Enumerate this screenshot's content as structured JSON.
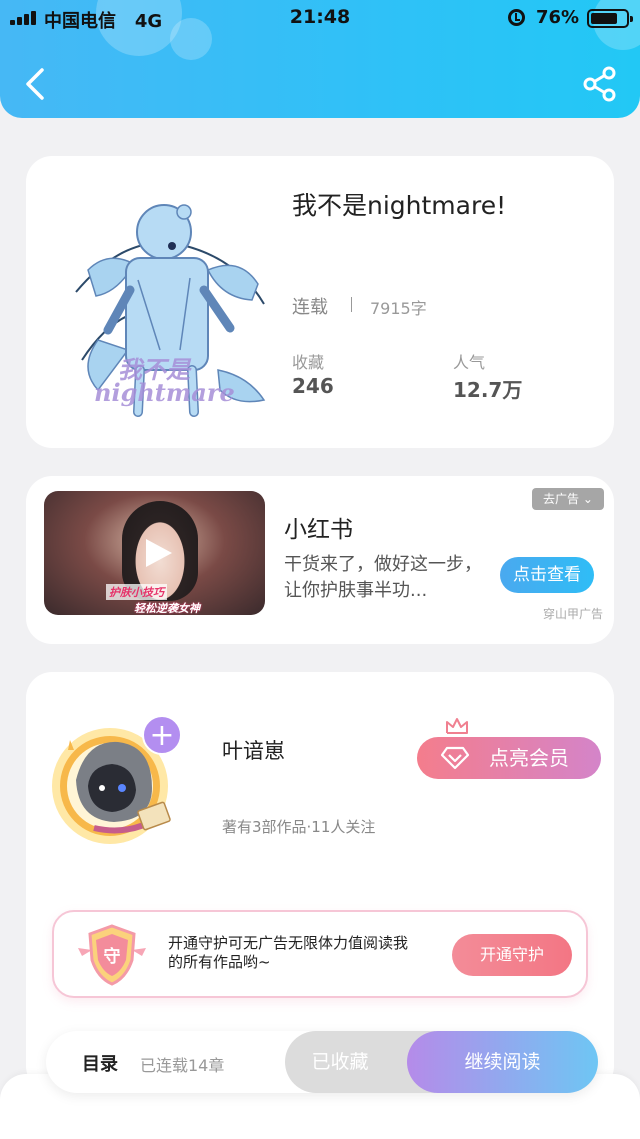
{
  "status_bar": {
    "carrier": "中国电信",
    "network": "4G",
    "time": "21:48",
    "battery_percent": "76%",
    "battery_level": 0.76
  },
  "header": {
    "back_icon": "chevron-left-icon",
    "share_icon": "share-icon"
  },
  "book": {
    "title": "我不是nightmare!",
    "status": "连载",
    "word_count": "7915字",
    "collect_label": "收藏",
    "collect_value": "246",
    "popularity_label": "人气",
    "popularity_value": "12.7万",
    "cover_text_line1": "我不是",
    "cover_text_line2": "nightmare"
  },
  "ad": {
    "remove_label": "去广告",
    "name": "小红书",
    "description": "干货来了，做好这一步，让你护肤事半功...",
    "cta_label": "点击查看",
    "source": "穿山甲广告",
    "video_caption1": "护肤小技巧",
    "video_caption2": "轻松逆袭女神"
  },
  "author": {
    "name": "叶谙崽",
    "stats": "著有3部作品·11人关注",
    "follow_icon": "plus-icon",
    "vip_label": "点亮会员",
    "guard_text": "开通守护可无广告无限体力值阅读我的所有作品哟~",
    "guard_badge": "守",
    "guard_button": "开通守护"
  },
  "bottom_bar": {
    "toc_label": "目录",
    "chapter_count": "已连载14章",
    "collected_label": "已收藏",
    "continue_label": "继续阅读"
  },
  "colors": {
    "header_blue": "#2fc1f7",
    "vip_pink": "#f47d8c",
    "guard_pink": "#f37684",
    "continue_purple": "#b58be9"
  }
}
